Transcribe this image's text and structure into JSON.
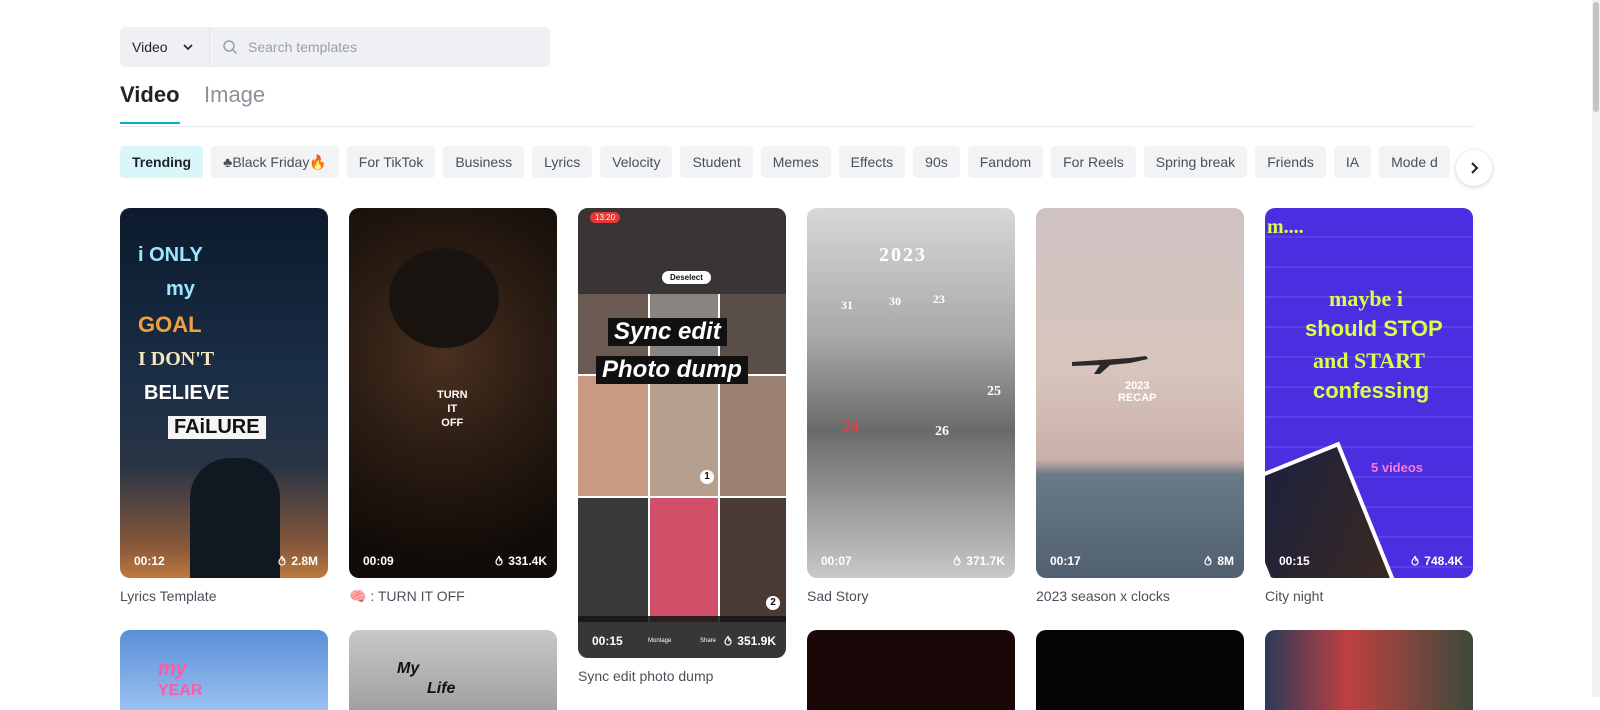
{
  "search": {
    "type_value": "Video",
    "placeholder": "Search templates"
  },
  "tabs": [
    {
      "label": "Video",
      "active": true
    },
    {
      "label": "Image",
      "active": false
    }
  ],
  "chips": [
    "Trending",
    "♣Black Friday🔥",
    "For TikTok",
    "Business",
    "Lyrics",
    "Velocity",
    "Student",
    "Memes",
    "Effects",
    "90s",
    "Fandom",
    "For Reels",
    "Spring break",
    "Friends",
    "IA",
    "Mode d"
  ],
  "cards": [
    {
      "title": "Lyrics Template",
      "duration": "00:12",
      "uses": "2.8M",
      "overlay": [
        "i ONLY",
        "my",
        "GOAL",
        "I DON'T",
        "BELIEVE",
        "FAiLURE"
      ]
    },
    {
      "title": "🧠 : TURN IT OFF",
      "duration": "00:09",
      "uses": "331.4K",
      "overlay": [
        "TURN",
        "IT",
        "OFF"
      ]
    },
    {
      "title": "Sync edit photo dump",
      "duration": "00:15",
      "uses": "351.9K",
      "overlay": [
        "Sync edit",
        "Photo dump",
        "Deselect",
        "13:20",
        "1",
        "2",
        "Montage",
        "Share"
      ]
    },
    {
      "title": "Sad Story",
      "duration": "00:07",
      "uses": "371.7K",
      "overlay": [
        "2023",
        "31",
        "30",
        "23",
        "25",
        "24",
        "26"
      ]
    },
    {
      "title": "2023 season x clocks",
      "duration": "00:17",
      "uses": "8M",
      "overlay": [
        "2023",
        "RECAP"
      ]
    },
    {
      "title": "City night",
      "duration": "00:15",
      "uses": "748.4K",
      "overlay": [
        "m....",
        "maybe i",
        "should STOP",
        "and START",
        "confessing",
        "5 videos"
      ]
    }
  ],
  "bottom_cards": [
    {
      "overlay": [
        "my",
        "YEAR"
      ]
    },
    {
      "overlay": [
        "My",
        "Life"
      ]
    }
  ],
  "colors": {
    "accent": "#00b2c9",
    "chip_active_bg": "#d9f6fa",
    "chip_bg": "#f1f3f5"
  }
}
